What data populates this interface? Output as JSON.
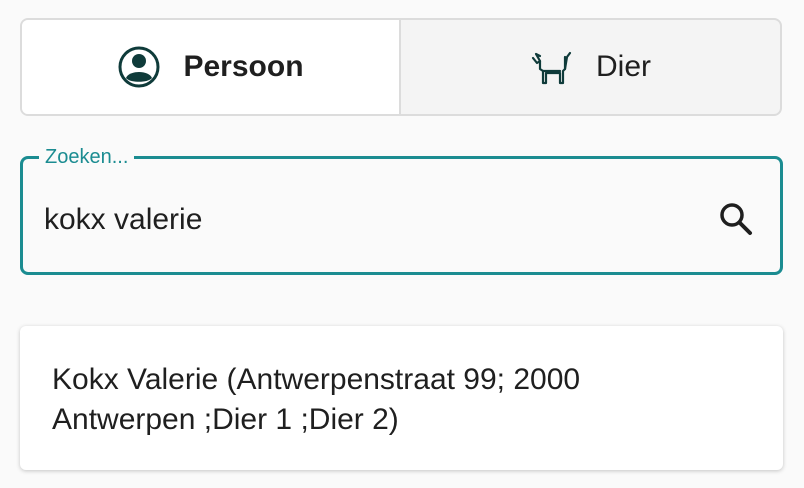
{
  "tabs": [
    {
      "label": "Persoon",
      "icon": "person-circle-icon",
      "active": true
    },
    {
      "label": "Dier",
      "icon": "dog-icon",
      "active": false
    }
  ],
  "search": {
    "label": "Zoeken...",
    "value": "kokx valerie",
    "icon": "search-icon"
  },
  "results": [
    {
      "text": "Kokx Valerie (Antwerpenstraat 99; 2000 Antwerpen ;Dier 1 ;Dier 2)"
    }
  ],
  "colors": {
    "accent": "#1b8c91",
    "icon_dark": "#0f3b3a"
  }
}
